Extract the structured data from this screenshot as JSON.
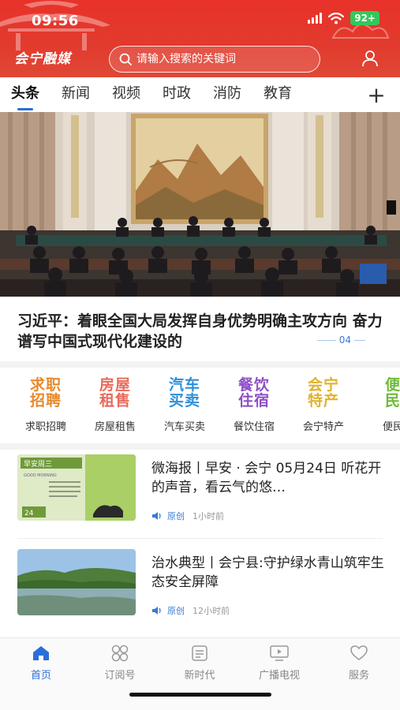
{
  "status": {
    "time": "09:56",
    "battery": "92+"
  },
  "header": {
    "brand": "会宁融媒",
    "search_placeholder": "请输入搜索的关键词",
    "profile_icon": "user-icon"
  },
  "tabs": [
    {
      "label": "头条",
      "active": true
    },
    {
      "label": "新闻"
    },
    {
      "label": "视频"
    },
    {
      "label": "时政"
    },
    {
      "label": "消防"
    },
    {
      "label": "教育"
    }
  ],
  "tab_add": "+",
  "hero": {
    "headline": "习近平：着眼全国大局发挥自身优势明确主攻方向 奋力谱写中国式现代化建设的",
    "pager": "04"
  },
  "services": [
    {
      "logo_top": "求职",
      "logo_bottom": "招聘",
      "label": "求职招聘",
      "color": "#e8892a"
    },
    {
      "logo_top": "房屋",
      "logo_bottom": "租售",
      "label": "房屋租售",
      "color": "#e86a5a"
    },
    {
      "logo_top": "汽车",
      "logo_bottom": "买卖",
      "label": "汽车买卖",
      "color": "#2e8fd8"
    },
    {
      "logo_top": "餐饮",
      "logo_bottom": "住宿",
      "label": "餐饮住宿",
      "color": "#8e4fc8"
    },
    {
      "logo_top": "会宁",
      "logo_bottom": "特产",
      "label": "会宁特产",
      "color": "#e2b12e"
    },
    {
      "logo_top": "便",
      "logo_bottom": "民",
      "label": "便民",
      "color": "#6fba3a"
    }
  ],
  "news": [
    {
      "title": "微海报丨早安 · 会宁 05月24日 听花开的声音，看云气的悠…",
      "tag": "原创",
      "time": "1小时前",
      "thumb_text": "早安周三",
      "thumb_sub": "GOOD MORNING",
      "thumb_date": "24"
    },
    {
      "title": "治水典型丨会宁县:守护绿水青山筑牢生态安全屏障",
      "tag": "原创",
      "time": "12小时前"
    }
  ],
  "bottom_nav": [
    {
      "label": "首页",
      "icon": "home-icon",
      "active": true
    },
    {
      "label": "订阅号",
      "icon": "subscribe-icon"
    },
    {
      "label": "新时代",
      "icon": "list-icon"
    },
    {
      "label": "广播电视",
      "icon": "tv-icon"
    },
    {
      "label": "服务",
      "icon": "service-icon"
    }
  ],
  "colors": {
    "brand_red": "#e8322a",
    "accent_blue": "#2a6fd8",
    "original_tag": "#3a7bd5"
  }
}
